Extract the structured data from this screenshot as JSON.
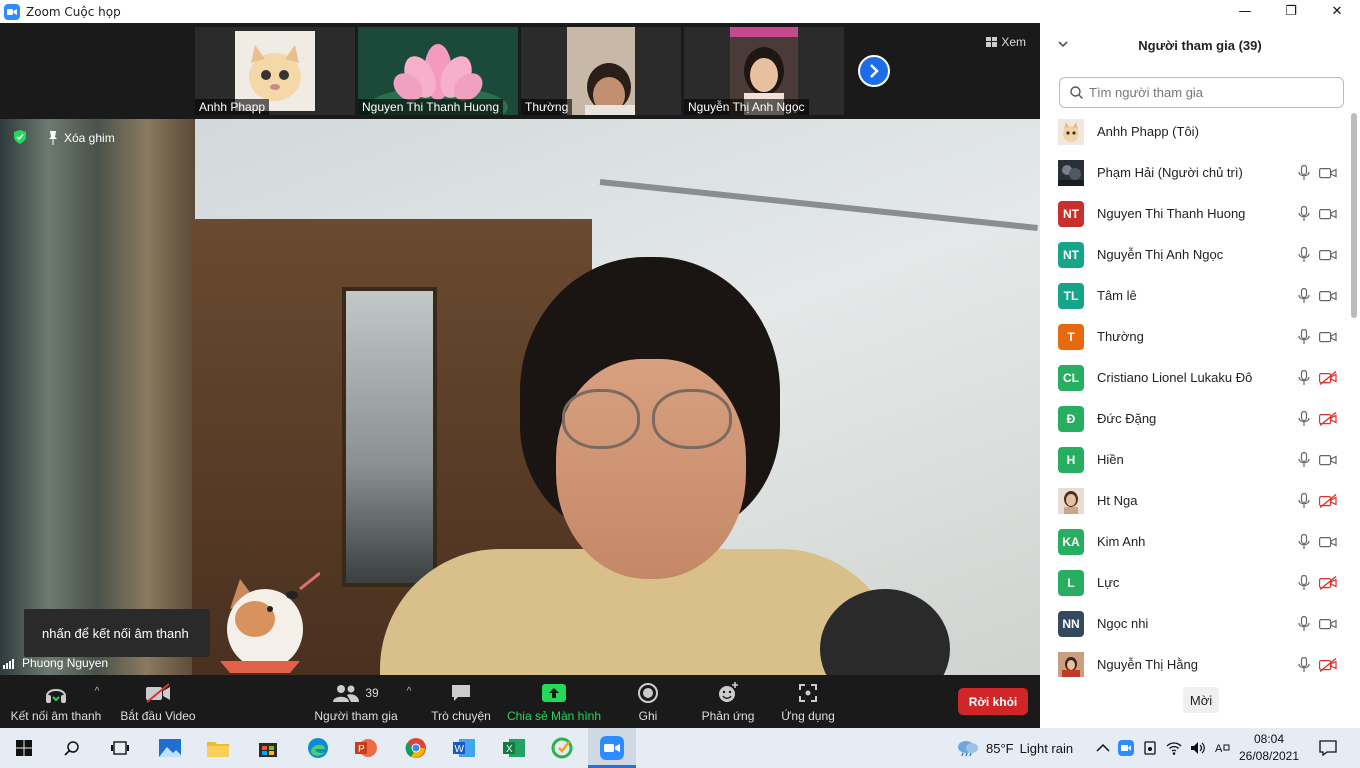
{
  "window": {
    "title": "Zoom Cuộc họp",
    "minimize": "—",
    "maximize": "❐",
    "close": "✕"
  },
  "thumbnails": [
    {
      "name": "Anhh Phapp"
    },
    {
      "name": "Nguyen Thi Thanh Huong"
    },
    {
      "name": "Thường"
    },
    {
      "name": "Nguyễn Thị Anh Ngọc"
    }
  ],
  "view_button": "Xem",
  "main_video": {
    "unpin_label": "Xóa ghim",
    "audio_tip": "nhấn để kết nối âm thanh",
    "speaker_name": "Phuong Nguyen"
  },
  "toolbar": {
    "audio": "Kết nối âm thanh",
    "video": "Bắt đầu Video",
    "participants": "Người tham gia",
    "participants_count": "39",
    "chat": "Trò chuyện",
    "share": "Chia sẻ Màn hình",
    "record": "Ghi",
    "reactions": "Phản ứng",
    "apps": "Ứng dụng",
    "leave": "Rời khỏi"
  },
  "panel": {
    "title": "Người tham gia (39)",
    "search_placeholder": "Tìm người tham gia",
    "invite": "Mời",
    "participants": [
      {
        "name": "Anhh Phapp (Tôi)",
        "initials": "",
        "avatar": "photo-cat",
        "color": "#e8e0d8",
        "muted": false,
        "video_off": false,
        "show_icons": false
      },
      {
        "name": "Phạm Hải (Người chủ trì)",
        "initials": "",
        "avatar": "photo-dark",
        "color": "#333a40",
        "muted": false,
        "video_off": false,
        "show_icons": true
      },
      {
        "name": "Nguyen Thi Thanh Huong",
        "initials": "NT",
        "avatar": "initials",
        "color": "#c9302c",
        "video_off": false,
        "show_icons": true
      },
      {
        "name": "Nguyễn Thị Anh Ngọc",
        "initials": "NT",
        "avatar": "initials",
        "color": "#17a589",
        "video_off": false,
        "show_icons": true
      },
      {
        "name": "Tâm lê",
        "initials": "TL",
        "avatar": "initials",
        "color": "#17a589",
        "video_off": false,
        "show_icons": true
      },
      {
        "name": "Thường",
        "initials": "T",
        "avatar": "initials",
        "color": "#e8680c",
        "video_off": false,
        "show_icons": true
      },
      {
        "name": "Cristiano Lionel Lukaku Đô",
        "initials": "CL",
        "avatar": "initials",
        "color": "#27ae60",
        "video_off": true,
        "show_icons": true
      },
      {
        "name": "Đức Đặng",
        "initials": "Đ",
        "avatar": "initials",
        "color": "#27ae60",
        "video_off": true,
        "show_icons": true
      },
      {
        "name": "Hiền",
        "initials": "H",
        "avatar": "initials",
        "color": "#27ae60",
        "video_off": false,
        "show_icons": true
      },
      {
        "name": "Ht Nga",
        "initials": "",
        "avatar": "photo-woman",
        "color": "#c8b8a8",
        "video_off": true,
        "show_icons": true
      },
      {
        "name": "Kim Anh",
        "initials": "KA",
        "avatar": "initials",
        "color": "#27ae60",
        "video_off": false,
        "show_icons": true
      },
      {
        "name": "Lực",
        "initials": "L",
        "avatar": "initials",
        "color": "#27ae60",
        "video_off": true,
        "show_icons": true
      },
      {
        "name": "Ngọc nhi",
        "initials": "NN",
        "avatar": "initials",
        "color": "#34495e",
        "video_off": false,
        "show_icons": true
      },
      {
        "name": "Nguyễn Thị Hằng",
        "initials": "",
        "avatar": "photo-red",
        "color": "#a84030",
        "video_off": true,
        "show_icons": true
      }
    ]
  },
  "taskbar": {
    "weather_temp": "85°F",
    "weather_text": "Light rain",
    "time": "08:04",
    "date": "26/08/2021",
    "apps": [
      "start-icon",
      "search-icon",
      "task-view-icon",
      "photos-icon",
      "file-explorer-icon",
      "store-icon",
      "edge-icon",
      "powerpoint-icon",
      "chrome-icon",
      "word-icon",
      "excel-icon",
      "app-icon",
      "zoom-icon"
    ]
  },
  "colors": {
    "accent_blue": "#2d8cff",
    "leave_red": "#d0262a",
    "share_green": "#23d959"
  }
}
